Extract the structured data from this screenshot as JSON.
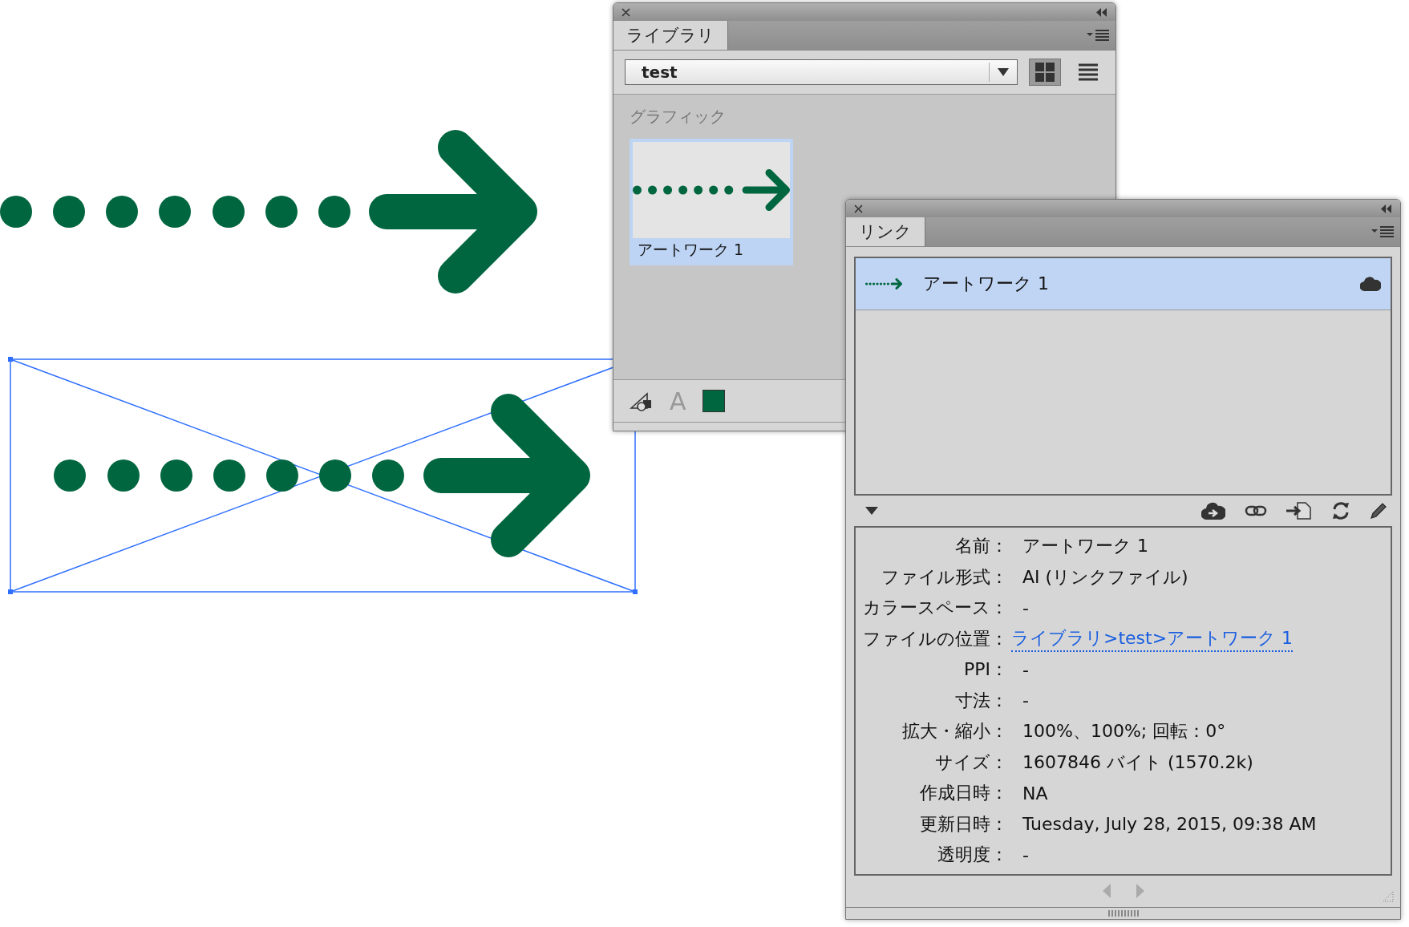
{
  "library_panel": {
    "tab": "ライブラリ",
    "library_select": "test",
    "view_modes": [
      {
        "kind": "grid",
        "selected": true
      },
      {
        "kind": "list",
        "selected": false
      }
    ],
    "section": "グラフィック",
    "items": [
      {
        "name": "アートワーク 1",
        "selected": true
      }
    ],
    "footer_tools": [
      {
        "kind": "shape"
      },
      {
        "kind": "text",
        "label": "A"
      },
      {
        "kind": "swatch",
        "color": "#00663f"
      }
    ]
  },
  "links_panel": {
    "tab": "リンク",
    "links": [
      {
        "name": "アートワーク 1",
        "selected": true
      }
    ],
    "info": [
      {
        "label": "名前：",
        "value": "アートワーク 1",
        "kind": "text"
      },
      {
        "label": "ファイル形式：",
        "value": "AI (リンクファイル)",
        "kind": "text"
      },
      {
        "label": "カラースペース：",
        "value": "-",
        "kind": "text"
      },
      {
        "label": "ファイルの位置：",
        "value": "ライブラリ>test>アートワーク 1",
        "kind": "link"
      },
      {
        "label": "PPI：",
        "value": "-",
        "kind": "text"
      },
      {
        "label": "寸法：",
        "value": "-",
        "kind": "text"
      },
      {
        "label": "拡大・縮小：",
        "value": "100%、100%; 回転：0°",
        "kind": "text"
      },
      {
        "label": "サイズ：",
        "value": "1607846 バイト (1570.2k)",
        "kind": "text"
      },
      {
        "label": "作成日時：",
        "value": "NA",
        "kind": "text"
      },
      {
        "label": "更新日時：",
        "value": "Tuesday, July 28, 2015, 09:38 AM",
        "kind": "text"
      },
      {
        "label": "透明度：",
        "value": "-",
        "kind": "text"
      }
    ]
  }
}
